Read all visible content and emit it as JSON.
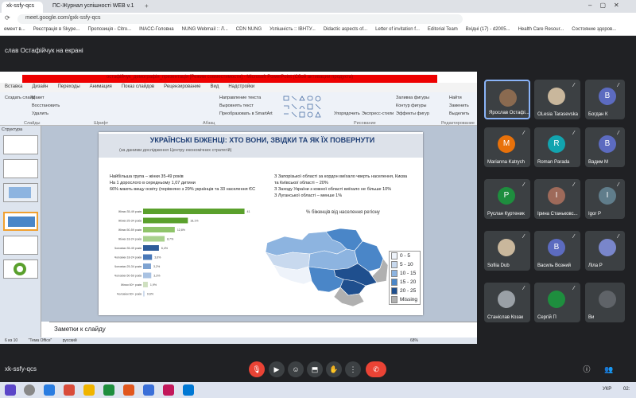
{
  "browser": {
    "tabs": [
      {
        "label": "xk-ssfy-qcs"
      },
      {
        "label": "ПС-Журнал успішності WEB v.1"
      }
    ],
    "url": "meet.google.com/gxk-ssfy-qcs",
    "bookmarks": [
      "емент в...",
      "Реєстрація в Skype...",
      "Пропозиція - Citro...",
      "INACC-Головна",
      "NUNG Webmail :: Л...",
      "CDN NUNG",
      "Успішність :: ІВНТУ...",
      "Didactic aspects of...",
      "Letter of invitation f...",
      "Editorial Team",
      "Вхідні (17) - d2005...",
      "Health Care Resour...",
      "Состояние здоров..."
    ]
  },
  "meet": {
    "presenting_label": "слав Остафійчук на екрані",
    "meeting_code": "xk-ssfy-qcs",
    "participants": [
      {
        "name": "Ярослав Остафі...",
        "initial": "",
        "color": "#8a6a50"
      },
      {
        "name": "OLesia Tarasevska",
        "initial": "",
        "color": "#c9b79c"
      },
      {
        "name": "Богдан К",
        "initial": "B",
        "color": "#5c6bc0"
      },
      {
        "name": "Marianna Katrych",
        "initial": "M",
        "color": "#e8710a"
      },
      {
        "name": "Roman Parada",
        "initial": "R",
        "color": "#12a4af"
      },
      {
        "name": "Вадим М",
        "initial": "B",
        "color": "#5c6bc0"
      },
      {
        "name": "Руслан Куртеник",
        "initial": "P",
        "color": "#1e8e3e"
      },
      {
        "name": "Ірина Станьковс...",
        "initial": "I",
        "color": "#9e6a5a"
      },
      {
        "name": "Igor P",
        "initial": "I",
        "color": "#607d8b"
      },
      {
        "name": "Sofiia Dub",
        "initial": "",
        "color": "#c9b79c"
      },
      {
        "name": "Василь Возний",
        "initial": "B",
        "color": "#5c6bc0"
      },
      {
        "name": "Ліла Р",
        "initial": "",
        "color": "#7986cb"
      },
      {
        "name": "Станіслав Козак",
        "initial": "",
        "color": "#9aa0a6"
      },
      {
        "name": "Сергій П",
        "initial": "",
        "color": "#1e8e3e"
      },
      {
        "name": "Ви",
        "initial": "",
        "color": "#5f6368"
      }
    ],
    "controls": [
      "mic-off",
      "camera",
      "emoji",
      "present",
      "hand",
      "more",
      "end-call",
      "info",
      "people"
    ]
  },
  "powerpoint": {
    "window_title": "остафійчук_демографія_презентація [Режим совместимости] - Microsoft PowerPoint (Сбой активации продукта)",
    "menu": [
      "Вставка",
      "Дизайн",
      "Переходы",
      "Анимация",
      "Показ слайдов",
      "Рецензирование",
      "Вид",
      "Надстройки"
    ],
    "ribbon_groups": [
      "Шрифт",
      "Абзац",
      "Рисование",
      "Редактирование"
    ],
    "ribbon_items": [
      "Создать слайд",
      "Макет",
      "Восстановить",
      "Удалить",
      "Направление текста",
      "Выровнять текст",
      "Преобразовать в SmartArt",
      "Упорядочить",
      "Экспресс-стили",
      "Заливка фигуры",
      "Контур фигуры",
      "Эффекты фигур",
      "Найти",
      "Заменить",
      "Выделить",
      "Слайды"
    ],
    "structure_tab": "Структура",
    "notes_placeholder": "Заметки к слайду",
    "status": [
      "6 из 10",
      "\"Тема Office\"",
      "русский"
    ],
    "zoom": "68%",
    "slide": {
      "title": "УКРАЇНСЬКІ БІЖЕНЦІ: ХТО ВОНИ, ЗВІДКИ ТА ЯК ЇХ ПОВЕРНУТИ",
      "subtitle": "(за даними дослідження  Центру  економічних  стратегій)",
      "bullets_left": [
        "Найбільша група – жінки 35-49 років",
        "На 1 дорослого в середньому 1,07 дитини",
        "66% мають вищу освіту (порівняно з 29% українців та 33 населення ЄС"
      ],
      "bullets_right": [
        "З Запорізької області за кордон виїхало чверть населення, Києва та Київської області – 20%",
        "З Заходу України з кожної області виїхало не більше 10%",
        "З Луганської області – менше 1%"
      ],
      "map_title": "% біженців від населення регіону",
      "map_legend": [
        {
          "label": "0 - 5",
          "color": "#eef3fa"
        },
        {
          "label": "5 - 10",
          "color": "#c8d9ee"
        },
        {
          "label": "10 - 15",
          "color": "#8db4e0"
        },
        {
          "label": "15 - 20",
          "color": "#4a86c8"
        },
        {
          "label": "20 - 25",
          "color": "#1f4f8e"
        },
        {
          "label": "Missing",
          "color": "#b0b0b0"
        }
      ]
    }
  },
  "chart_data": {
    "type": "bar",
    "orientation": "horizontal",
    "categories": [
      "Жінки 35-49 років",
      "Жінки 25-34 років",
      "Жінки 50-59 років",
      "Жінки 18-24 років",
      "Чоловіки 35-49 років",
      "Чоловіки 18-24 років",
      "Чоловіки 25-34 років",
      "Чоловіки 50-59 років",
      "Жінки 60+ років",
      "Чоловіки 60+ років"
    ],
    "values": [
      41,
      18.1,
      12.8,
      8.7,
      6.4,
      3.6,
      3.2,
      3.3,
      1.9,
      0.6
    ],
    "value_labels": [
      "41",
      "18,1%",
      "12,8%",
      "8,7%",
      "6,4%",
      "3,6%",
      "3,2%",
      "3,3%",
      "1,9%",
      "0,6%"
    ],
    "colors": [
      "#5aa02c",
      "#5aa02c",
      "#8fc46a",
      "#a9d18e",
      "#2e5c9a",
      "#4a79b8",
      "#7ea3d1",
      "#a9c2e2",
      "#cfe0c0",
      "#cfdcee"
    ],
    "xlim": [
      0,
      45
    ]
  },
  "taskbar": {
    "tray_lang": "УКР",
    "tray_time": "02:"
  }
}
